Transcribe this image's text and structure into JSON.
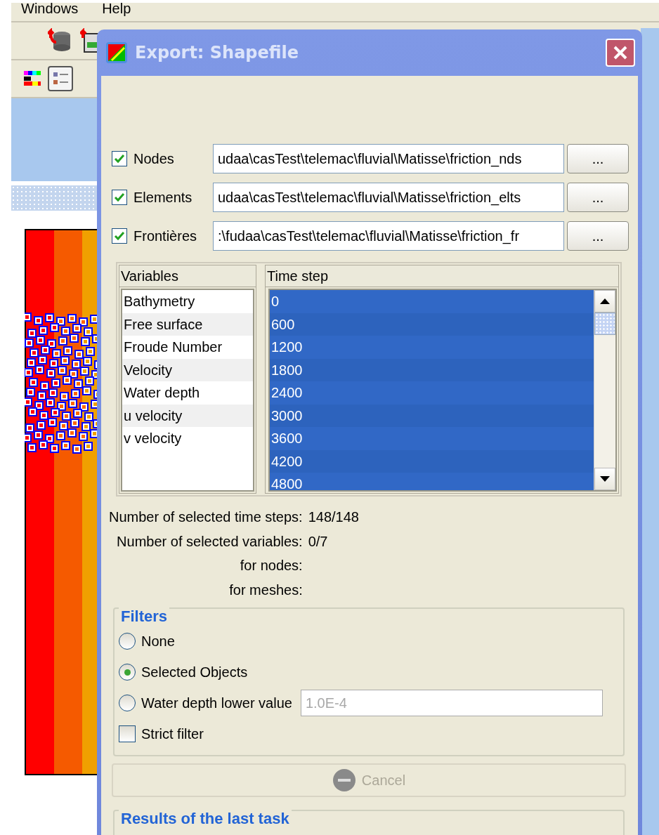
{
  "menu": [
    {
      "label": "Windows"
    },
    {
      "label": "Help"
    }
  ],
  "dialog": {
    "title": "Export: Shapefile",
    "outputs": [
      {
        "label": "Nodes",
        "checked": true,
        "path": "udaa\\casTest\\telemac\\fluvial\\Matisse\\friction_nds",
        "button": "..."
      },
      {
        "label": "Elements",
        "checked": true,
        "path": "udaa\\casTest\\telemac\\fluvial\\Matisse\\friction_elts",
        "button": "..."
      },
      {
        "label": "Frontières",
        "checked": true,
        "path": ":\\fudaa\\casTest\\telemac\\fluvial\\Matisse\\friction_fr",
        "button": "..."
      }
    ],
    "variables": {
      "header": "Variables",
      "items": [
        {
          "label": "Bathymetry",
          "selected": false
        },
        {
          "label": "Free surface",
          "selected": false
        },
        {
          "label": "Froude Number",
          "selected": false
        },
        {
          "label": "Velocity",
          "selected": false
        },
        {
          "label": "Water depth",
          "selected": false
        },
        {
          "label": "u velocity",
          "selected": false
        },
        {
          "label": "v velocity",
          "selected": false
        }
      ]
    },
    "time_steps": {
      "header": "Time step",
      "items": [
        {
          "label": "0",
          "selected": true
        },
        {
          "label": "600",
          "selected": true
        },
        {
          "label": "1200",
          "selected": true
        },
        {
          "label": "1800",
          "selected": true
        },
        {
          "label": "2400",
          "selected": true
        },
        {
          "label": "3000",
          "selected": true
        },
        {
          "label": "3600",
          "selected": true
        },
        {
          "label": "4200",
          "selected": true
        },
        {
          "label": "4800",
          "selected": true
        }
      ]
    },
    "summary": [
      {
        "label": "Number of selected time steps:",
        "value": "148/148"
      },
      {
        "label": "Number of selected variables:",
        "value": "0/7"
      },
      {
        "label": "for nodes:"
      },
      {
        "label": "for meshes:"
      }
    ],
    "filters": {
      "title": "Filters",
      "options": [
        {
          "label": "None",
          "selected": false
        },
        {
          "label": "Selected Objects",
          "selected": true
        },
        {
          "label": "Water depth lower value",
          "selected": false,
          "disabled": true,
          "value": "1.0E-4"
        }
      ],
      "strict": {
        "label": "Strict filter",
        "checked": false
      }
    },
    "cancel": {
      "label": "Cancel",
      "disabled": true
    },
    "results": {
      "title": "Results of the last task"
    }
  }
}
